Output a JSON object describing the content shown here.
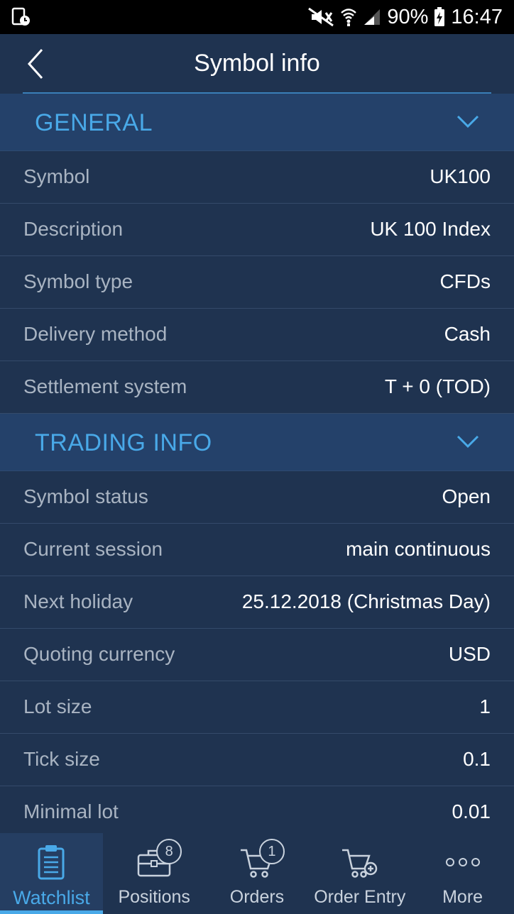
{
  "status_bar": {
    "battery": "90%",
    "time": "16:47"
  },
  "header": {
    "title": "Symbol info"
  },
  "sections": [
    {
      "title": "GENERAL",
      "rows": [
        {
          "label": "Symbol",
          "value": "UK100"
        },
        {
          "label": "Description",
          "value": "UK 100 Index"
        },
        {
          "label": "Symbol type",
          "value": "CFDs"
        },
        {
          "label": "Delivery method",
          "value": "Cash"
        },
        {
          "label": "Settlement system",
          "value": "T + 0 (TOD)"
        }
      ]
    },
    {
      "title": "TRADING INFO",
      "rows": [
        {
          "label": "Symbol status",
          "value": "Open"
        },
        {
          "label": "Current session",
          "value": "main continuous"
        },
        {
          "label": "Next holiday",
          "value": "25.12.2018 (Christmas Day)"
        },
        {
          "label": "Quoting currency",
          "value": "USD"
        },
        {
          "label": "Lot size",
          "value": "1"
        },
        {
          "label": "Tick size",
          "value": "0.1"
        },
        {
          "label": "Minimal lot",
          "value": "0.01"
        }
      ]
    }
  ],
  "bottom_nav": {
    "items": [
      {
        "label": "Watchlist",
        "icon": "clipboard-icon",
        "active": true
      },
      {
        "label": "Positions",
        "icon": "briefcase-icon",
        "badge": "8"
      },
      {
        "label": "Orders",
        "icon": "cart-icon",
        "badge": "1"
      },
      {
        "label": "Order Entry",
        "icon": "cart-add-icon"
      },
      {
        "label": "More",
        "icon": "more-dots-icon"
      }
    ]
  },
  "colors": {
    "background": "#1f3350",
    "section_header_bg": "#24416a",
    "accent": "#49a9e8",
    "label_text": "#a9b4c2",
    "value_text": "#ffffff"
  }
}
